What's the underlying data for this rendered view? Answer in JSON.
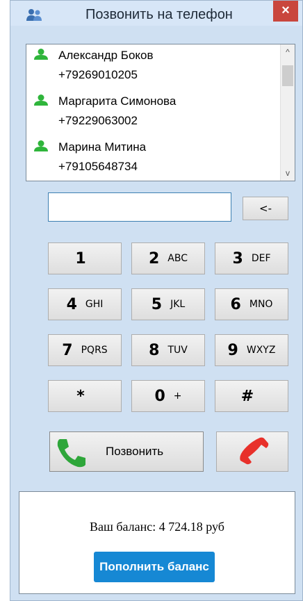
{
  "window": {
    "title": "Позвонить на телефон",
    "close_label": "×"
  },
  "contacts": [
    {
      "name": "Александр Боков",
      "phone": "+79269010205"
    },
    {
      "name": "Маргарита Симонова",
      "phone": "+79229063002"
    },
    {
      "name": "Марина Митина",
      "phone": "+79105648734"
    }
  ],
  "scrollbar": {
    "up": "^",
    "down": "v"
  },
  "dialer": {
    "input_value": "",
    "backspace_label": "<-",
    "keys": [
      {
        "main": "1",
        "sub": ""
      },
      {
        "main": "2",
        "sub": "ABC"
      },
      {
        "main": "3",
        "sub": "DEF"
      },
      {
        "main": "4",
        "sub": "GHI"
      },
      {
        "main": "5",
        "sub": "JKL"
      },
      {
        "main": "6",
        "sub": "MNO"
      },
      {
        "main": "7",
        "sub": "PQRS"
      },
      {
        "main": "8",
        "sub": "TUV"
      },
      {
        "main": "9",
        "sub": "WXYZ"
      },
      {
        "main": "*",
        "sub": ""
      },
      {
        "main": "0",
        "sub": "+"
      },
      {
        "main": "#",
        "sub": ""
      }
    ],
    "call_label": "Позвонить",
    "icons": {
      "call": "phone-green-icon",
      "hangup": "phone-red-icon",
      "contact": "person-icon",
      "app": "people-icon"
    }
  },
  "balance": {
    "text": "Ваш баланс: 4 724.18 руб",
    "topup_label": "Пополнить баланс"
  },
  "colors": {
    "accent": "#1688d4",
    "close": "#c9463d",
    "call": "#2ea63a",
    "hangup": "#e8302a",
    "contact_icon": "#2fb53b"
  }
}
